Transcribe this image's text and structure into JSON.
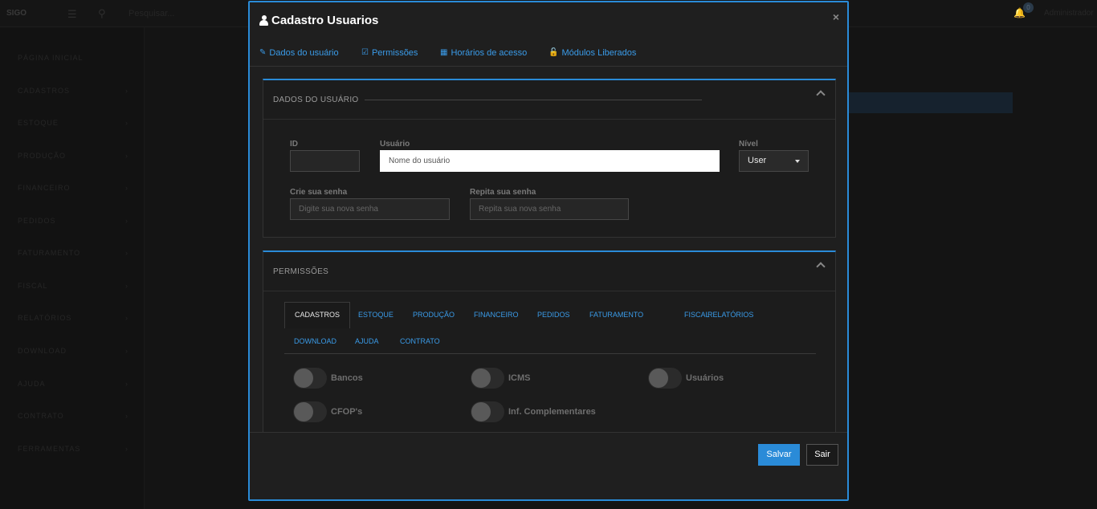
{
  "background": {
    "logo": "SIGO",
    "search_placeholder": "Pesquisar...",
    "badge": "0",
    "user": "Administrador",
    "sidebar_items": [
      {
        "label": "PÁGINA INICIAL"
      },
      {
        "label": "CADASTROS"
      },
      {
        "label": "ESTOQUE"
      },
      {
        "label": "PRODUÇÃO"
      },
      {
        "label": "FINANCEIRO"
      },
      {
        "label": "PEDIDOS"
      },
      {
        "label": "FATURAMENTO"
      },
      {
        "label": "FISCAL"
      },
      {
        "label": "RELATÓRIOS"
      },
      {
        "label": "DOWNLOAD"
      },
      {
        "label": "AJUDA"
      },
      {
        "label": "CONTRATO"
      },
      {
        "label": "FERRAMENTAS"
      }
    ]
  },
  "modal": {
    "title": "Cadastro Usuarios",
    "close": "×",
    "nav": [
      {
        "label": "Dados do usuário",
        "icon": "edit-icon"
      },
      {
        "label": "Permissões",
        "icon": "checkbox-icon"
      },
      {
        "label": "Horários de acesso",
        "icon": "calendar-icon"
      },
      {
        "label": "Módulos Liberados",
        "icon": "unlock-icon"
      }
    ],
    "dados_panel": {
      "title": "DADOS DO USUÁRIO",
      "id_label": "ID",
      "id_value": "",
      "usuario_label": "Usuário",
      "usuario_placeholder": "Nome do usuário",
      "nivel_label": "Nível",
      "nivel_value": "User",
      "senha_label": "Crie sua senha",
      "senha_placeholder": "Digite sua nova senha",
      "repita_label": "Repita sua senha",
      "repita_placeholder": "Repita sua nova senha"
    },
    "permissoes_panel": {
      "title": "PERMISSÕES",
      "tabs": [
        "CADASTROS",
        "ESTOQUE",
        "PRODUÇÃO",
        "FINANCEIRO",
        "PEDIDOS",
        "FATURAMENTO",
        "FISCAL",
        "RELATÓRIOS",
        "DOWNLOAD",
        "AJUDA",
        "CONTRATO"
      ],
      "active_tab": "CADASTROS",
      "toggles": [
        {
          "label": "Bancos",
          "on": false
        },
        {
          "label": "ICMS",
          "on": false
        },
        {
          "label": "Usuários",
          "on": false
        },
        {
          "label": "CFOP's",
          "on": false
        },
        {
          "label": "Inf. Complementares",
          "on": false
        }
      ]
    },
    "footer": {
      "save": "Salvar",
      "exit": "Sair"
    }
  },
  "colors": {
    "accent": "#2a8bd8",
    "link": "#3a9be8",
    "surface": "#1f1f1f"
  }
}
